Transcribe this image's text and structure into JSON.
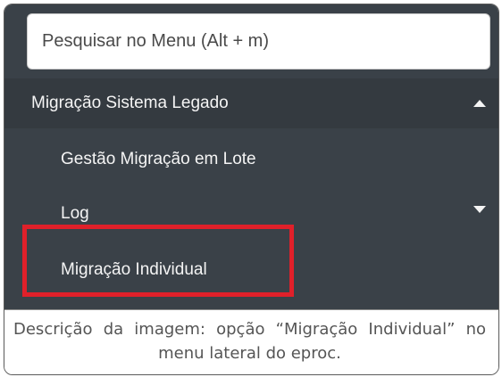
{
  "search": {
    "placeholder": "Pesquisar no Menu (Alt + m)"
  },
  "menu": {
    "group": {
      "label": "Migração Sistema Legado",
      "state": "expanded"
    },
    "items": [
      {
        "label": "Gestão Migração em Lote"
      },
      {
        "label": "Log",
        "has_submenu": true
      },
      {
        "label": "Migração Individual",
        "highlighted": true
      }
    ]
  },
  "caption": "Descrição da imagem: opção “Migração Individual” no menu lateral do eproc.",
  "colors": {
    "menu_background": "#3a4148",
    "group_header_background": "#343a40",
    "menu_text": "#f4f4f4",
    "highlight_border": "#e0202a"
  }
}
